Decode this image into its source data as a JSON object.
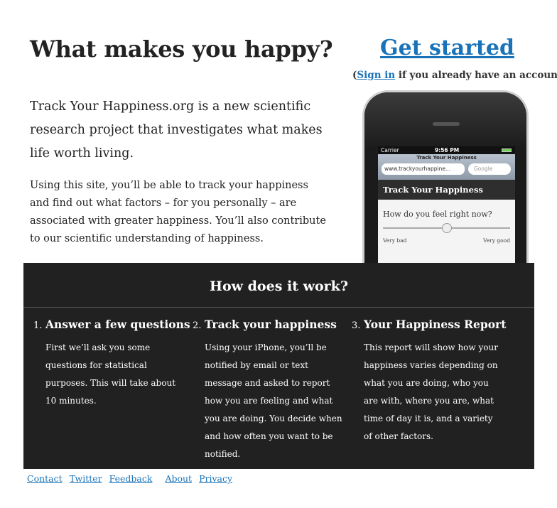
{
  "hero": {
    "headline": "What makes you happy?",
    "intro": "Track Your Happiness.org is a new scientific research project that investigates what makes life worth living.",
    "body": "Using this site, you’ll be able to track your happiness and find out what factors – for you personally – are associated with greater happiness. You’ll also contribute to our scientific understanding of happiness."
  },
  "cta": {
    "get_started": "Get started",
    "signin_prefix": "(",
    "signin_link": "Sign in",
    "signin_suffix": " if you already have an account)"
  },
  "phone": {
    "carrier": "Carrier",
    "time": "9:56 PM",
    "browser_title": "Track Your Happiness",
    "url": "www.trackyourhappine...",
    "search_placeholder": "Google",
    "app_title": "Track Your Happiness",
    "question": "How do you feel right now?",
    "slider_low": "Very bad",
    "slider_high": "Very good",
    "slider_value": 0.5
  },
  "how": {
    "title": "How does it work?",
    "steps": [
      {
        "num": "1.",
        "title": "Answer a few questions",
        "desc": "First we’ll ask you some questions for statistical purposes. This will take about 10 minutes."
      },
      {
        "num": "2.",
        "title": "Track your happiness",
        "desc": "Using your iPhone, you’ll be notified by email or text message and asked to report how you are feeling and what you are doing. You decide when and how often you want to be notified."
      },
      {
        "num": "3.",
        "title": "Your Happiness Report",
        "desc": "This report will show how your happiness varies depending on what you are doing, who you are with, where you are, what time of day it is, and a variety of other factors."
      }
    ]
  },
  "footer": {
    "links": [
      "Contact",
      "Twitter",
      "Feedback",
      "About",
      "Privacy"
    ]
  },
  "colors": {
    "link": "#1a73b8",
    "dark_panel": "#212121"
  }
}
